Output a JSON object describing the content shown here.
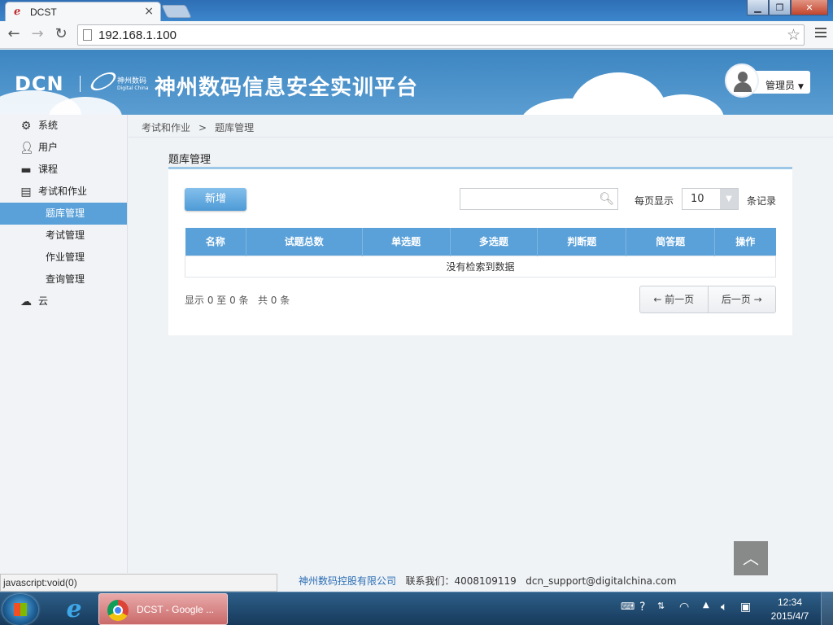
{
  "browser": {
    "tab_title": "DCST",
    "tab_close": "×",
    "url": "192.168.1.100",
    "status_text": "javascript:void(0)"
  },
  "header": {
    "logo_text": "DCN",
    "dc_logo_cn": "神州数码",
    "dc_logo_en": "Digital China",
    "platform_title": "神州数码信息安全实训平台",
    "user_label": "管理员"
  },
  "sidebar": {
    "items": [
      {
        "label": "系统",
        "icon": "gear-icon"
      },
      {
        "label": "用户",
        "icon": "user-icon"
      },
      {
        "label": "课程",
        "icon": "book-icon"
      },
      {
        "label": "考试和作业",
        "icon": "clipboard-icon"
      },
      {
        "label": "题库管理",
        "active": true
      },
      {
        "label": "考试管理"
      },
      {
        "label": "作业管理"
      },
      {
        "label": "查询管理"
      },
      {
        "label": "云",
        "icon": "cloud-icon"
      }
    ]
  },
  "breadcrumb": {
    "parent": "考试和作业",
    "separator": ">",
    "current": "题库管理"
  },
  "panel": {
    "title": "题库管理",
    "add_button": "新增",
    "search_value": "",
    "page_size_label": "每页显示",
    "page_size_value": "10",
    "records_label": "条记录",
    "columns": [
      "名称",
      "试题总数",
      "单选题",
      "多选题",
      "判断题",
      "简答题",
      "操作"
    ],
    "empty_message": "没有检索到数据",
    "summary": "显示 0 至 0 条   共 0 条",
    "prev_page": "← 前一页",
    "next_page": "后一页 →"
  },
  "footer": {
    "company": "神州数码控股有限公司",
    "contact": "联系我们：4008109119",
    "email": "dcn_support@digitalchina.com"
  },
  "taskbar": {
    "chrome_task_label": "DCST - Google ...",
    "time": "12:34",
    "date": "2015/4/7"
  },
  "colors": {
    "accent": "#5aa1d9",
    "banner": "#4a91c9",
    "link": "#2a6db4"
  }
}
